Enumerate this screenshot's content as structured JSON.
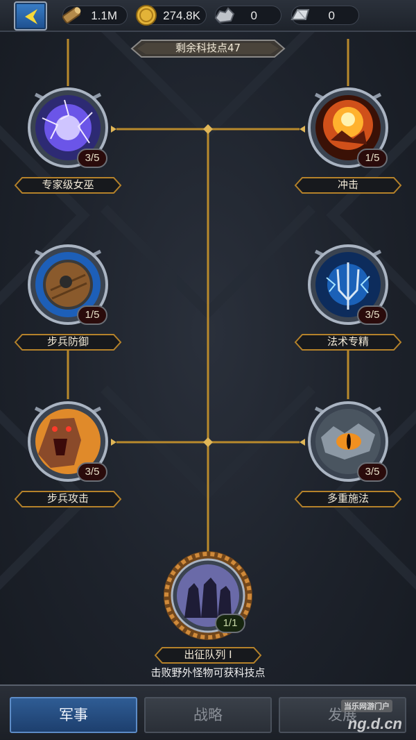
{
  "resources": [
    {
      "icon": "wood-log-icon",
      "value": "1.1M"
    },
    {
      "icon": "gold-coin-icon",
      "value": "274.8K"
    },
    {
      "icon": "ore-icon",
      "value": "0"
    },
    {
      "icon": "iron-ingot-icon",
      "value": "0"
    }
  ],
  "skill_points": "剩余科技点47",
  "skills": [
    {
      "name": "专家级女巫",
      "level": "3/5",
      "icon": "lightning-orb-icon"
    },
    {
      "name": "冲击",
      "level": "1/5",
      "icon": "fire-impact-icon"
    },
    {
      "name": "步兵防御",
      "level": "1/5",
      "icon": "shield-icon"
    },
    {
      "name": "法术专精",
      "level": "3/5",
      "icon": "lightning-trident-icon"
    },
    {
      "name": "步兵攻击",
      "level": "3/5",
      "icon": "roaring-warrior-icon"
    },
    {
      "name": "多重施法",
      "level": "3/5",
      "icon": "dragon-eye-icon"
    },
    {
      "name": "出征队列 I",
      "level": "1/1",
      "icon": "army-silhouette-icon"
    }
  ],
  "hint": "击败野外怪物可获科技点",
  "tabs": [
    {
      "label": "军事",
      "active": true
    },
    {
      "label": "战略",
      "active": false
    },
    {
      "label": "发展",
      "active": false
    }
  ],
  "watermark": {
    "main": "ng.d.cn",
    "sub": "当乐网游门户"
  }
}
